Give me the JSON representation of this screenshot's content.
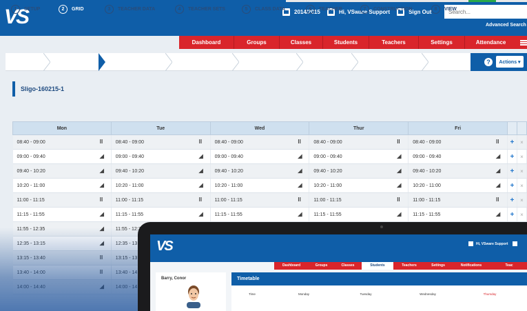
{
  "header": {
    "logo": "VS",
    "year": "2014/2015",
    "greeting": "Hi, VSware Support",
    "sign_out": "Sign Out",
    "search_placeholder": "Search...",
    "advanced_search": "Advanced Search"
  },
  "nav": [
    "Dashboard",
    "Groups",
    "Classes",
    "Students",
    "Teachers",
    "Settings",
    "Attendance"
  ],
  "steps": [
    {
      "num": "1",
      "label": "SETUP"
    },
    {
      "num": "2",
      "label": "GRID"
    },
    {
      "num": "3",
      "label": "TEACHER DATA"
    },
    {
      "num": "4",
      "label": "TEACHER SETS"
    },
    {
      "num": "5",
      "label": "CLASS DATA"
    },
    {
      "num": "6",
      "label": "TEACHER"
    },
    {
      "num": "7",
      "label": "CONSTRUCTION"
    },
    {
      "num": "8",
      "label": "VIEW"
    }
  ],
  "active_step_index": 1,
  "actions_label": "Actions",
  "page_title": "Sligo-160215-1",
  "grid": {
    "days": [
      "Mon",
      "Tue",
      "Wed",
      "Thur",
      "Fri"
    ],
    "rows": [
      {
        "time": "08:40 - 09:00",
        "icon": "fork-knife-icon"
      },
      {
        "time": "09:00 - 09:40",
        "icon": "graduation-cap-icon"
      },
      {
        "time": "09:40 - 10:20",
        "icon": "graduation-cap-icon"
      },
      {
        "time": "10:20 - 11:00",
        "icon": "graduation-cap-icon"
      },
      {
        "time": "11:00 - 11:15",
        "icon": "fork-knife-icon"
      },
      {
        "time": "11:15 - 11:55",
        "icon": "graduation-cap-icon"
      },
      {
        "time": "11:55 - 12:35",
        "icon": "graduation-cap-icon"
      },
      {
        "time": "12:35 - 13:15",
        "icon": "graduation-cap-icon"
      },
      {
        "time": "13:15 - 13:40",
        "icon": "fork-knife-icon"
      },
      {
        "time": "13:40 - 14:00",
        "icon": "fork-knife-icon"
      },
      {
        "time": "14:00 - 14:40",
        "icon": "graduation-cap-icon"
      }
    ]
  },
  "tablet": {
    "logo": "VS",
    "greeting": "Hi, VSware Support",
    "nav": [
      "Dashboard",
      "Groups",
      "Classes",
      "Students",
      "Teachers",
      "Settings",
      "Notifications",
      "Teac"
    ],
    "active_nav": "Students",
    "student_name": "Barry, Conor",
    "timetable_title": "Timetable",
    "timetable_cols": [
      "Time",
      "Monday",
      "Tuesday",
      "Wednesday",
      "Thursday"
    ]
  },
  "colors": {
    "brand_blue": "#0f5ea8",
    "nav_red": "#d9252b"
  }
}
